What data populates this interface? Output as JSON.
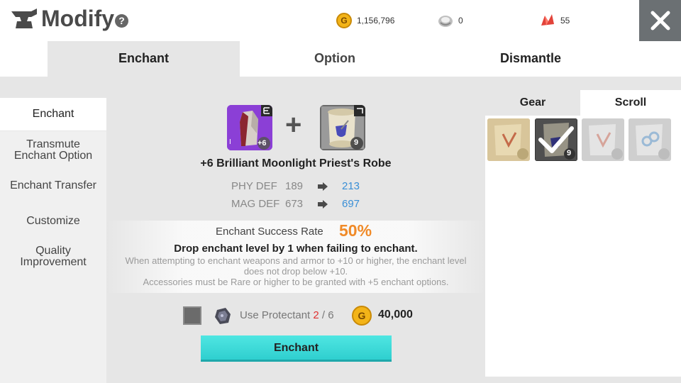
{
  "header": {
    "title": "Modify",
    "help": "?",
    "gold_symbol": "G",
    "gold": "1,156,796",
    "silver": "0",
    "red_crystal": "55"
  },
  "tabs": [
    {
      "label": "Enchant",
      "active": true
    },
    {
      "label": "Option",
      "active": false
    },
    {
      "label": "Dismantle",
      "active": false
    }
  ],
  "left_nav": {
    "enchant": "Enchant",
    "transmute_1": "Transmute",
    "transmute_2": "Enchant Option",
    "transfer": "Enchant Transfer",
    "customize": "Customize",
    "quality_1": "Quality",
    "quality_2": "Improvement"
  },
  "item": {
    "level_badge": "+6",
    "name": "+6 Brilliant Moonlight Priest's Robe",
    "grade_mark": "I",
    "scroll_count": "9"
  },
  "stats": {
    "phy_label": "PHY DEF",
    "phy_old": "189",
    "phy_new": "213",
    "mag_label": "MAG DEF",
    "mag_old": "673",
    "mag_new": "697"
  },
  "rate": {
    "label": "Enchant Success Rate",
    "value": "50%",
    "warning": "Drop enchant level by 1 when failing to enchant.",
    "note1": "When attempting to enchant weapons and armor to +10 or higher, the enchant level",
    "note2": "does not drop below +10.",
    "note3": "Accessories must be Rare or higher to be granted with +5 enchant options."
  },
  "protectant": {
    "label": "Use Protectant",
    "have": "2",
    "need": "/ 6",
    "coin_symbol": "G",
    "cost": "40,000"
  },
  "enchant_button": "Enchant",
  "right_panel": {
    "tab_gear": "Gear",
    "tab_scroll": "Scroll",
    "selected_count": "9"
  },
  "colors": {
    "accent_cyan": "#3ad8d8",
    "rate_orange": "#f08a28",
    "stat_blue": "#3a8fd6",
    "protectant_red": "#e03030"
  }
}
